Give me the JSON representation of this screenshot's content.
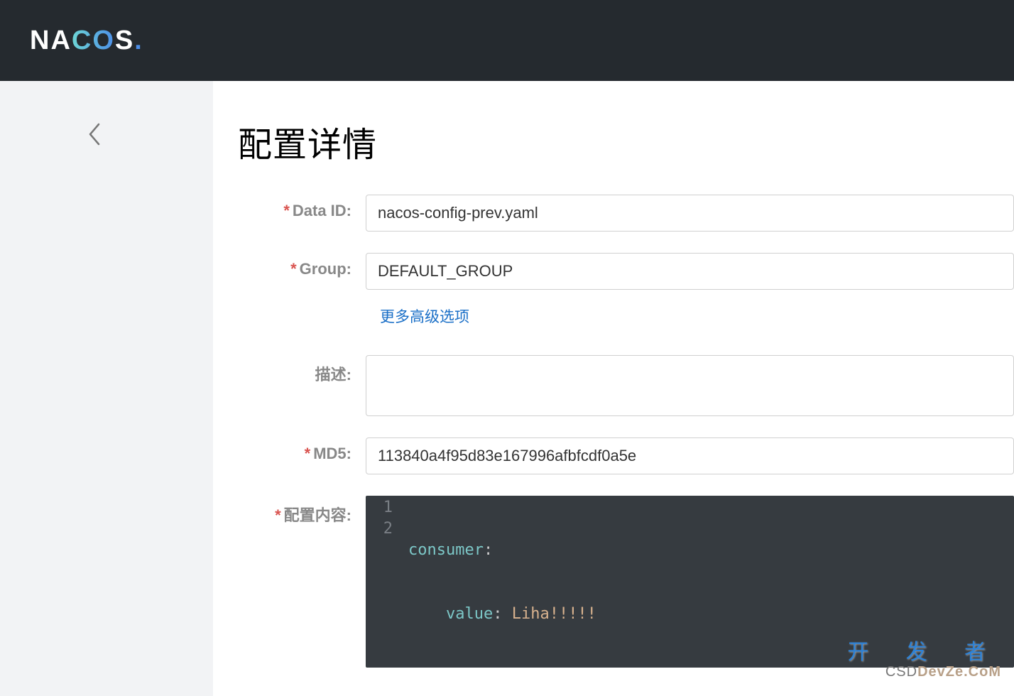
{
  "brand": {
    "name": "NACOS"
  },
  "page": {
    "title": "配置详情"
  },
  "form": {
    "dataId": {
      "label": "Data ID:",
      "value": "nacos-config-prev.yaml",
      "required": true
    },
    "group": {
      "label": "Group:",
      "value": "DEFAULT_GROUP",
      "required": true
    },
    "advancedLink": "更多高级选项",
    "description": {
      "label": "描述:",
      "value": "",
      "required": false
    },
    "md5": {
      "label": "MD5:",
      "value": "113840a4f95d83e167996afbfcdf0a5e",
      "required": true
    },
    "content": {
      "label": "配置内容:",
      "required": true,
      "lines": [
        {
          "num": "1",
          "key": "consumer",
          "value": "",
          "indent": 0
        },
        {
          "num": "2",
          "key": "value",
          "value": "Liha!!!!!",
          "indent": 1
        }
      ]
    }
  },
  "watermark": {
    "top": "开 发 者",
    "bottom_left": "CSD",
    "bottom_right": "DevZe.CoM"
  }
}
